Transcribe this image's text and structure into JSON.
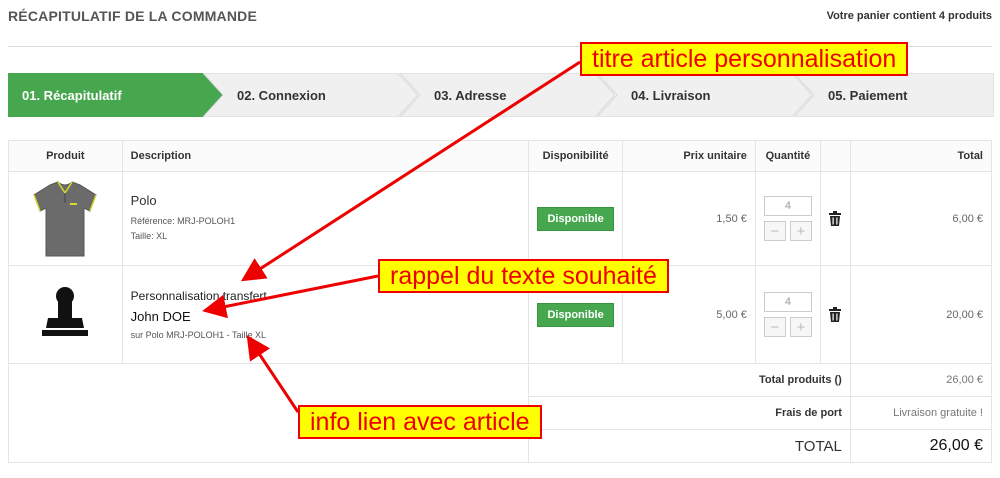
{
  "header": {
    "title": "RÉCAPITULATIF DE LA COMMANDE",
    "cart_count": "Votre panier contient 4 produits"
  },
  "steps": [
    {
      "label": "01. Récapitulatif",
      "active": true
    },
    {
      "label": "02. Connexion",
      "active": false
    },
    {
      "label": "03. Adresse",
      "active": false
    },
    {
      "label": "04. Livraison",
      "active": false
    },
    {
      "label": "05. Paiement",
      "active": false
    }
  ],
  "table": {
    "headers": {
      "product": "Produit",
      "description": "Description",
      "availability": "Disponibilité",
      "unit_price": "Prix unitaire",
      "quantity": "Quantité",
      "total": "Total"
    },
    "rows": [
      {
        "name": "Polo",
        "reference": "Référence: MRJ-POLOH1",
        "size": "Taille: XL",
        "availability": "Disponible",
        "unit_price": "1,50 €",
        "quantity": "4",
        "total": "6,00 €",
        "image_icon": "polo-shirt-icon"
      },
      {
        "title": "Personnalisation transfert",
        "custom_text": "John DOE",
        "link_info": "sur Polo MRJ-POLOH1 - Taille XL",
        "availability": "Disponible",
        "unit_price": "5,00 €",
        "quantity": "4",
        "total": "20,00 €",
        "image_icon": "stamp-icon"
      }
    ],
    "totals": {
      "products_label": "Total produits ()",
      "products_value": "26,00 €",
      "shipping_label": "Frais de port",
      "shipping_value": "Livraison gratuite !",
      "grand_label": "TOTAL",
      "grand_value": "26,00 €"
    }
  },
  "annotations": {
    "title": "titre article personnalisation",
    "text": "rappel du texte souhaité",
    "link": "info lien avec article"
  },
  "colors": {
    "active_step": "#46a74e",
    "badge": "#46a74e",
    "annotation_bg": "#ffff00",
    "annotation_border": "#e00000"
  }
}
